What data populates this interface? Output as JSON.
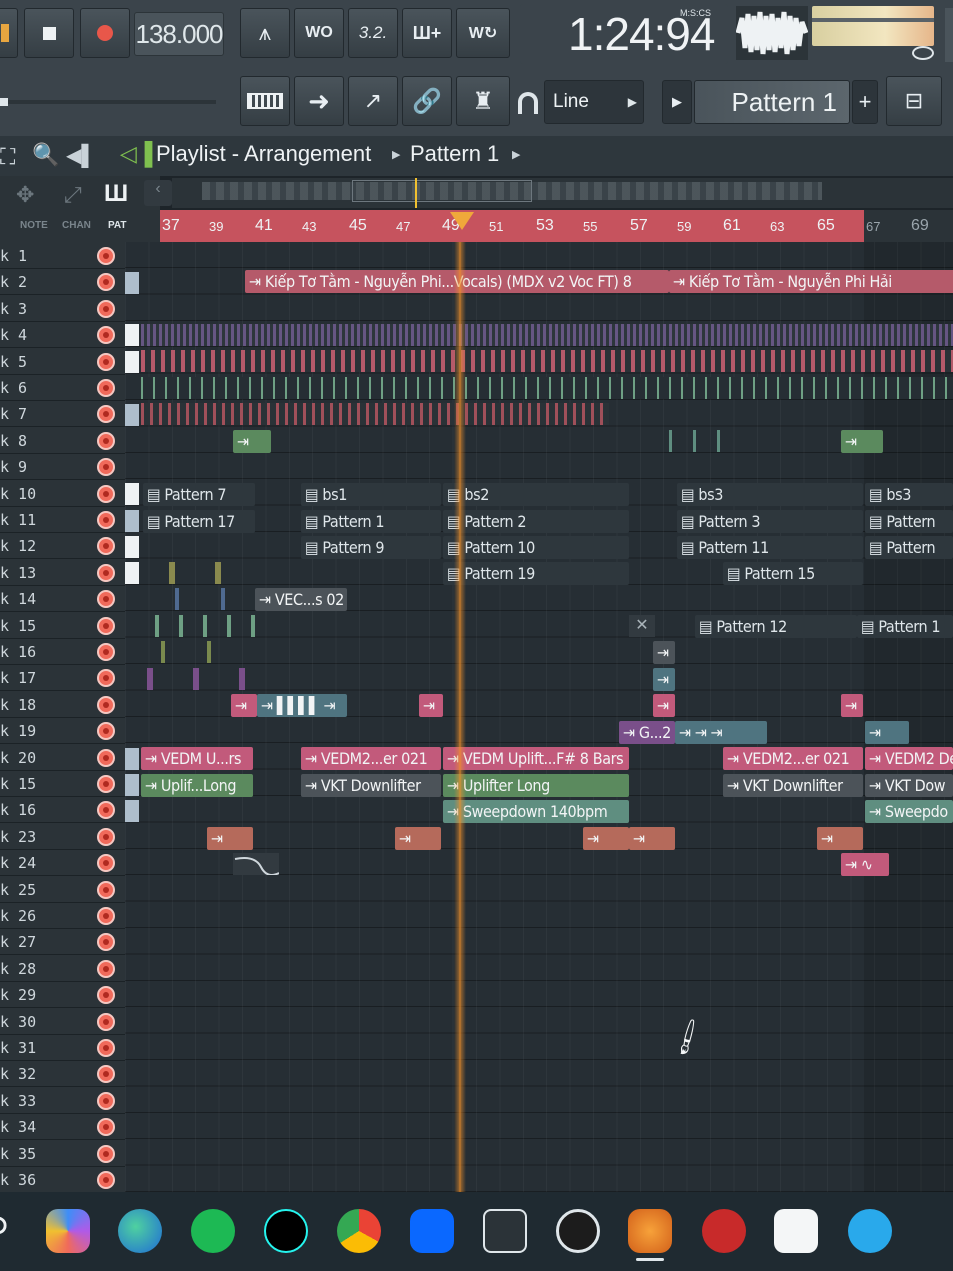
{
  "toolbar": {
    "tempo": "138.000",
    "time_display": "1:24:94",
    "time_format": "M:S:CS",
    "snap_mode": "Line",
    "pattern_selector": "Pattern 1",
    "add_label": "+"
  },
  "playlist": {
    "title": "Playlist - Arrangement",
    "pattern": "Pattern 1",
    "tabs": [
      "NOTE",
      "CHAN",
      "PAT"
    ]
  },
  "timeline": {
    "labels": [
      "37",
      "39",
      "41",
      "43",
      "45",
      "47",
      "49",
      "51",
      "53",
      "55",
      "57",
      "59",
      "61",
      "63",
      "65",
      "67",
      "69"
    ]
  },
  "tracks": [
    "k 1",
    "k 2",
    "k 3",
    "k 4",
    "k 5",
    "k 6",
    "k 7",
    "k 8",
    "k 9",
    "k 10",
    "k 11",
    "k 12",
    "k 13",
    "k 14",
    "k 15",
    "k 16",
    "k 17",
    "k 18",
    "k 19",
    "k 20",
    "k 15",
    "k 16",
    "k 23",
    "k 24",
    "k 25",
    "k 26",
    "k 27",
    "k 28",
    "k 29",
    "k 30",
    "k 31",
    "k 32",
    "k 33",
    "k 34",
    "k 35",
    "k 36"
  ],
  "clips": {
    "vocal_a": "Kiếp Tơ Tằm - Nguyễn Phi...Vocals) (MDX v2 Voc FT) 8",
    "vocal_b": "Kiếp Tơ Tằm - Nguyễn Phi Hải",
    "p7": "Pattern 7",
    "bs1": "bs1",
    "bs2": "bs2",
    "bs3a": "bs3",
    "bs3b": "bs3",
    "p17": "Pattern 17",
    "p1": "Pattern 1",
    "p2": "Pattern 2",
    "p3": "Pattern 3",
    "p_cut1": "Pattern",
    "p9": "Pattern 9",
    "p10": "Pattern 10",
    "p11": "Pattern 11",
    "p_cut2": "Pattern",
    "p19": "Pattern 19",
    "p15": "Pattern 15",
    "vec": "VEC...s 02",
    "p12": "Pattern 12",
    "p_cut3": "Pattern 1",
    "g2": "G...2",
    "vedm1": "VEDM U...rs",
    "vedm2": "VEDM2...er 021",
    "vedm3": "VEDM Uplift...F# 8 Bars",
    "vedm4": "VEDM2...er 021",
    "vedm5": "VEDM2 De",
    "upl1": "Uplif...Long",
    "vkt1": "VKT Downlifter",
    "upl2": "Uplifter Long",
    "vkt2": "VKT Downlifter",
    "vkt3": "VKT Dow",
    "sweep1": "Sweepdown 140bpm",
    "sweep2": "Sweepdo"
  },
  "dock_apps": [
    "search",
    "copilot",
    "edge",
    "spotify",
    "tiktok",
    "chrome",
    "zalo",
    "perplexity",
    "obs",
    "fl-studio",
    "game",
    "capcut",
    "telegram"
  ],
  "colors": {
    "playhead": "#f0902a",
    "ruler_accent": "#c6535e",
    "lcd": "#1a2024"
  }
}
